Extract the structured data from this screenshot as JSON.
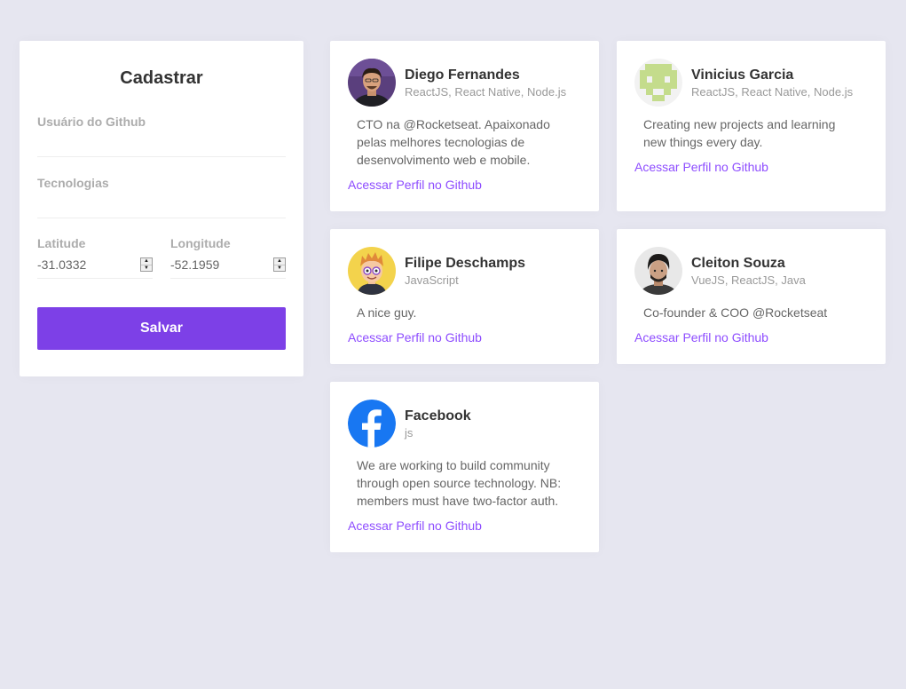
{
  "form": {
    "title": "Cadastrar",
    "github_user_label": "Usuário do Github",
    "github_user_value": "",
    "techs_label": "Tecnologias",
    "techs_value": "",
    "latitude_label": "Latitude",
    "latitude_value": "-31.0332",
    "longitude_label": "Longitude",
    "longitude_value": "-52.1959",
    "submit_label": "Salvar"
  },
  "colors": {
    "background": "#e6e6f0",
    "primary_button": "#7d40e7",
    "link": "#8e4dff"
  },
  "devs": [
    {
      "name": "Diego Fernandes",
      "techs": "ReactJS, React Native, Node.js",
      "bio": "CTO na @Rocketseat. Apaixonado pelas melhores tecnologias de desenvolvimento web e mobile.",
      "link_label": "Acessar Perfil no Github",
      "avatar_icon": "person-photo-avatar"
    },
    {
      "name": "Vinicius Garcia",
      "techs": "ReactJS, React Native, Node.js",
      "bio": "Creating new projects and learning new things every day.",
      "link_label": "Acessar Perfil no Github",
      "avatar_icon": "identicon-avatar"
    },
    {
      "name": "Filipe Deschamps",
      "techs": "JavaScript",
      "bio": "A nice guy.",
      "link_label": "Acessar Perfil no Github",
      "avatar_icon": "cartoon-avatar"
    },
    {
      "name": "Cleiton Souza",
      "techs": "VueJS, ReactJS, Java",
      "bio": "Co-founder & COO @Rocketseat",
      "link_label": "Acessar Perfil no Github",
      "avatar_icon": "person-photo-avatar"
    },
    {
      "name": "Facebook",
      "techs": "js",
      "bio": "We are working to build community through open source technology. NB: members must have two-factor auth.",
      "link_label": "Acessar Perfil no Github",
      "avatar_icon": "facebook-logo-avatar"
    }
  ]
}
